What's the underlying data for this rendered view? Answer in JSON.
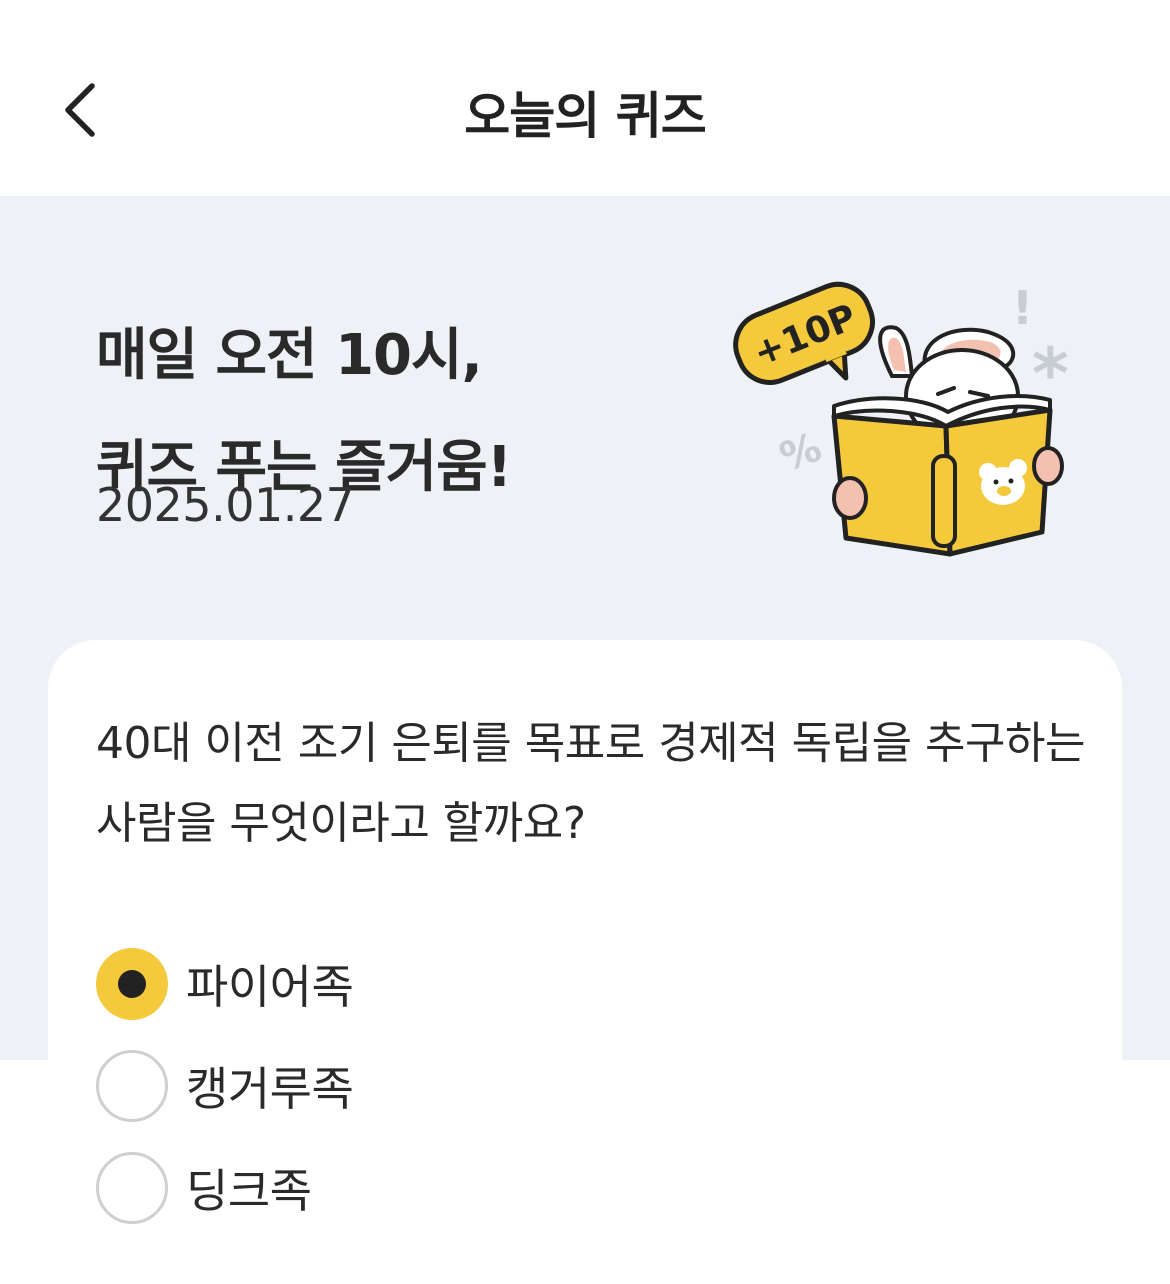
{
  "header": {
    "title": "오늘의 퀴즈",
    "back_icon": "chevron-left-icon"
  },
  "hero": {
    "title_line1": "매일 오전 10시,",
    "title_line2": "퀴즈 푸는 즐거움!",
    "date": "2025.01.27",
    "illustration": {
      "badge": "+10P",
      "marks": [
        "!",
        "*",
        "%"
      ]
    }
  },
  "quiz": {
    "question": "40대 이전 조기 은퇴를 목표로 경제적 독립을 추구하는 사람을 무엇이라고 할까요?",
    "options": [
      {
        "label": "파이어족",
        "selected": true
      },
      {
        "label": "캥거루족",
        "selected": false
      },
      {
        "label": "딩크족",
        "selected": false
      }
    ]
  },
  "colors": {
    "accent": "#f5c93c",
    "hero_bg": "#eef1f6",
    "text": "#222222"
  }
}
